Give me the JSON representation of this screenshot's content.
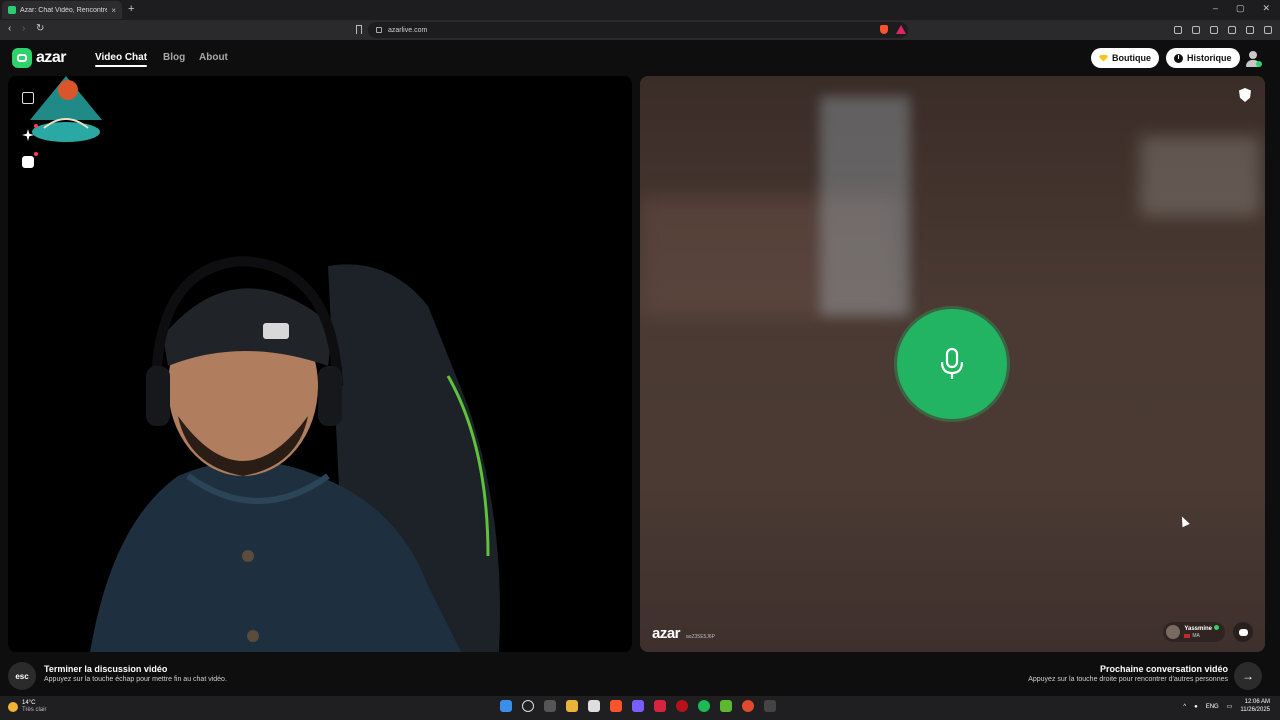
{
  "browser": {
    "tab_title": "Azar: Chat Vidéo, Rencontrer",
    "tab_close": "×",
    "new_tab": "+",
    "url": "azarlive.com",
    "window_controls": [
      "–",
      "▢",
      "✕"
    ]
  },
  "site": {
    "logo_text": "azar",
    "nav": [
      "Video Chat",
      "Blog",
      "About"
    ],
    "shop_label": "Boutique",
    "history_label": "Historique",
    "brand_color": "#2fd36b"
  },
  "remote": {
    "watermark": "azar",
    "watermark_id": "aoZ35E5J6P",
    "peer_name": "Yassmine",
    "peer_country": "MA"
  },
  "bottom": {
    "esc_key": "esc",
    "end_title": "Terminer la discussion vidéo",
    "end_sub": "Appuyez sur la touche échap pour mettre fin au chat vidéo.",
    "next_title": "Prochaine conversation vidéo",
    "next_sub": "Appuyez sur la touche droite pour rencontrer d'autres personnes",
    "next_icon": "→"
  },
  "taskbar": {
    "temp": "14°C",
    "weather": "Très clair",
    "lang": "ENG",
    "time": "12:06 AM",
    "date": "11/26/2025"
  },
  "icons": {
    "stream_overlay": "Argan",
    "mic": "microphone-icon",
    "shield": "shield-icon"
  }
}
